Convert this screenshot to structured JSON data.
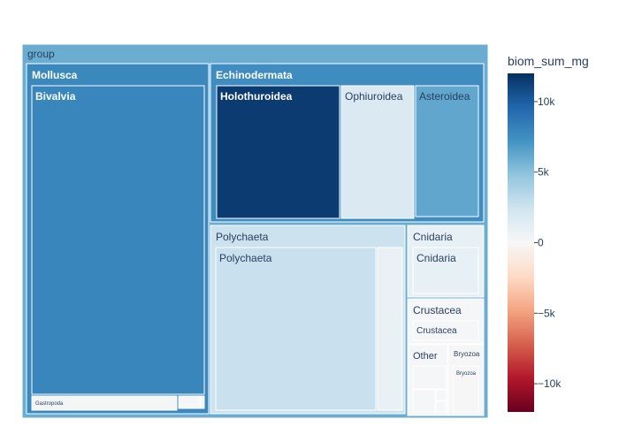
{
  "chart_data": {
    "type": "treemap",
    "root_label": "group",
    "color_metric": "biom_sum_mg",
    "colorbar": {
      "title": "biom_sum_mg",
      "range": [
        -12000,
        12000
      ],
      "ticks": [
        {
          "value": 10000,
          "label": "10k"
        },
        {
          "value": 5000,
          "label": "5k"
        },
        {
          "value": 0,
          "label": "0"
        },
        {
          "value": -5000,
          "label": "−5k"
        },
        {
          "value": -10000,
          "label": "−10k"
        }
      ],
      "colorscale": [
        "#67001f",
        "#b2182b",
        "#d6604d",
        "#f4a582",
        "#fddbc7",
        "#f7f7f7",
        "#d1e5f0",
        "#92c5de",
        "#4393c3",
        "#2166ac",
        "#053061"
      ]
    },
    "root_value": 6000,
    "groups": [
      {
        "label": "Mollusca",
        "value": 7800,
        "children": [
          {
            "label": "Bivalvia",
            "value": 7900
          },
          {
            "label": "Gastropoda",
            "value": 200
          },
          {
            "label": "",
            "value": 150
          },
          {
            "label": "",
            "value": 100
          }
        ]
      },
      {
        "label": "Echinodermata",
        "value": 7500,
        "children": [
          {
            "label": "Holothuroidea",
            "value": 11500
          },
          {
            "label": "Ophiuroidea",
            "value": 1800
          },
          {
            "label": "Asteroidea",
            "value": 6300
          }
        ]
      },
      {
        "label": "Polychaeta",
        "value": 2600,
        "children": [
          {
            "label": "Polychaeta",
            "value": 2700
          },
          {
            "label": "",
            "value": 800
          }
        ]
      },
      {
        "label": "Cnidaria",
        "value": 1000,
        "children": [
          {
            "label": "Cnidaria",
            "value": 1000
          }
        ]
      },
      {
        "label": "Crustacea",
        "value": 150,
        "children": [
          {
            "label": "Crustacea",
            "value": 150
          }
        ]
      },
      {
        "label": "Other",
        "value": 100,
        "children": [
          {
            "label": "",
            "value": 100
          },
          {
            "label": "",
            "value": 100
          },
          {
            "label": "",
            "value": 100
          },
          {
            "label": "",
            "value": 100
          }
        ]
      },
      {
        "label": "Bryozoa",
        "value": 80,
        "children": [
          {
            "label": "Bryozoa",
            "value": 80
          }
        ]
      }
    ]
  }
}
